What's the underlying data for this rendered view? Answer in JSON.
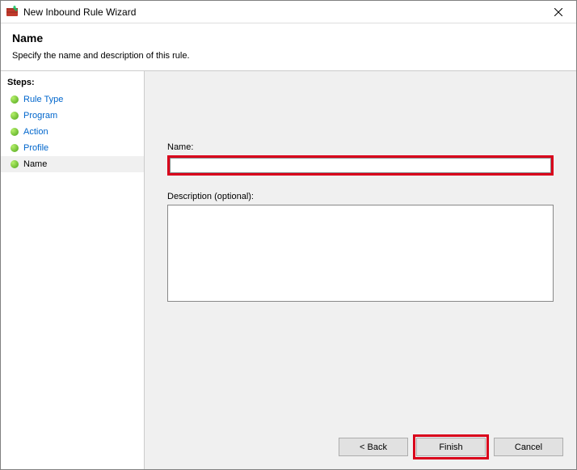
{
  "window": {
    "title": "New Inbound Rule Wizard"
  },
  "header": {
    "title": "Name",
    "subtitle": "Specify the name and description of this rule."
  },
  "sidebar": {
    "steps_label": "Steps:",
    "steps": [
      {
        "label": "Rule Type",
        "active": false
      },
      {
        "label": "Program",
        "active": false
      },
      {
        "label": "Action",
        "active": false
      },
      {
        "label": "Profile",
        "active": false
      },
      {
        "label": "Name",
        "active": true
      }
    ]
  },
  "form": {
    "name_label": "Name:",
    "name_value": "",
    "desc_label": "Description (optional):",
    "desc_value": ""
  },
  "buttons": {
    "back": "< Back",
    "finish": "Finish",
    "cancel": "Cancel"
  },
  "highlights": {
    "color": "#d9001b"
  }
}
